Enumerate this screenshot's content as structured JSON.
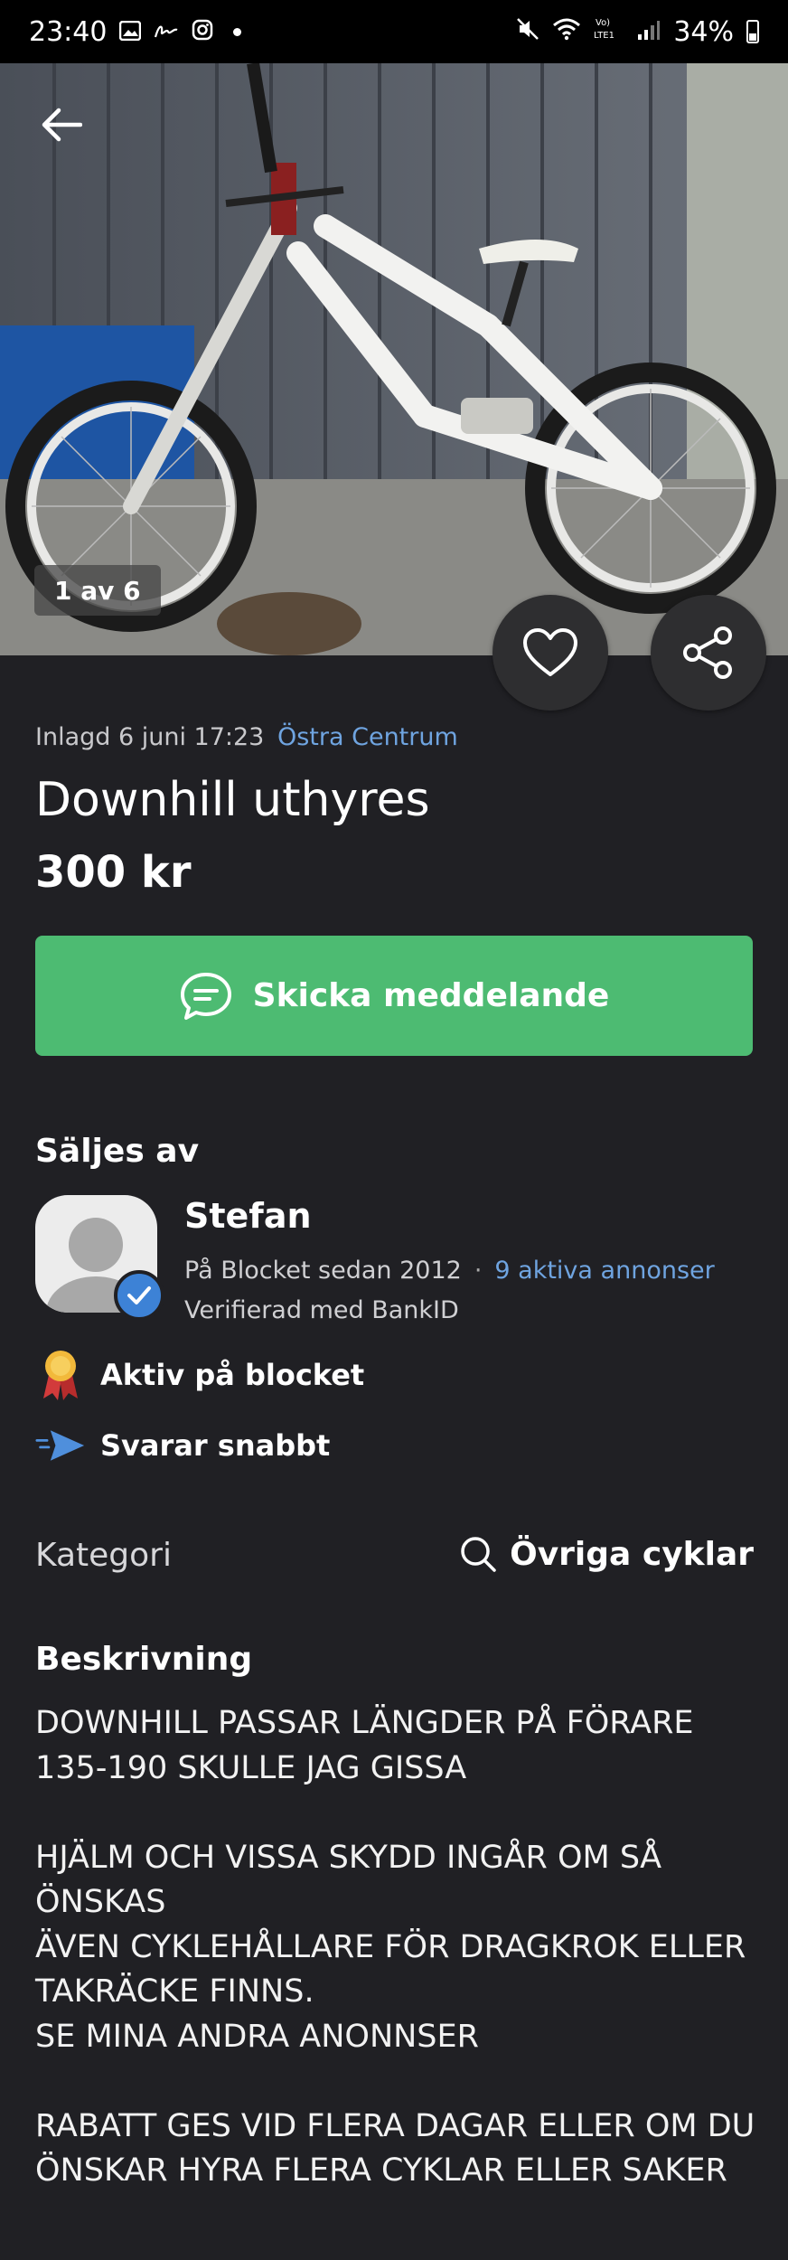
{
  "status_bar": {
    "time": "23:40",
    "battery": "34%",
    "network": "LTE1"
  },
  "hero": {
    "counter": "1 av 6"
  },
  "listing": {
    "posted": "Inlagd 6 juni 17:23",
    "location": "Östra Centrum",
    "title": "Downhill uthyres",
    "price": "300 kr"
  },
  "cta": {
    "label": "Skicka meddelande"
  },
  "seller": {
    "heading": "Säljes av",
    "name": "Stefan",
    "since": "På Blocket sedan 2012",
    "active_ads": "9 aktiva annonser",
    "verified": "Verifierad med BankID",
    "perks": [
      {
        "label": "Aktiv på blocket"
      },
      {
        "label": "Svarar snabbt"
      }
    ]
  },
  "category": {
    "label": "Kategori",
    "value": "Övriga cyklar"
  },
  "description": {
    "heading": "Beskrivning",
    "text": "DOWNHILL PASSAR LÄNGDER PÅ FÖRARE 135-190 SKULLE JAG GISSA\n\nHJÄLM OCH VISSA SKYDD INGÅR OM SÅ ÖNSKAS\nÄVEN CYKLEHÅLLARE FÖR DRAGKROK ELLER TAKRÄCKE FINNS.\nSE MINA ANDRA ANONNSER\n\nRABATT GES VID FLERA DAGAR ELLER OM DU ÖNSKAR HYRA FLERA CYKLAR ELLER SAKER"
  },
  "colors": {
    "background": "#202024",
    "accent_green": "#4dbb72",
    "link_blue": "#6fa4e0",
    "verified_blue": "#3d82d6"
  }
}
